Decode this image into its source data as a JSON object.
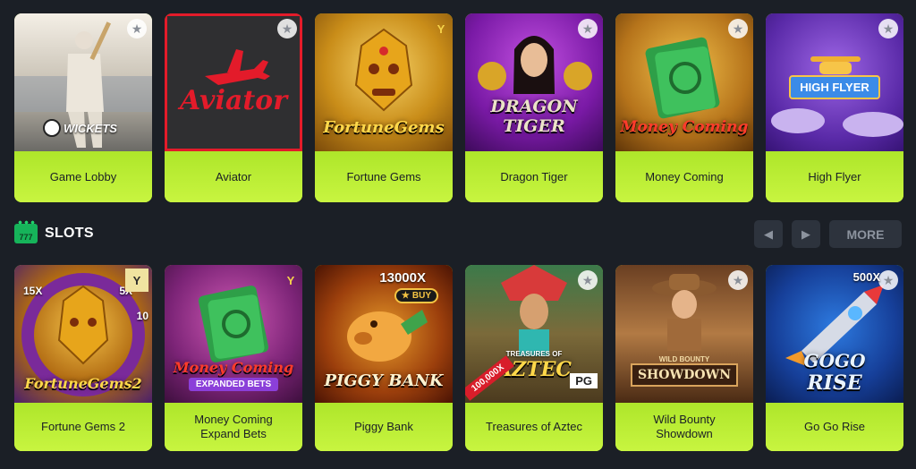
{
  "top_games": [
    {
      "label": "Game Lobby",
      "art_text": "WICKETS"
    },
    {
      "label": "Aviator",
      "art_text": "Aviator"
    },
    {
      "label": "Fortune Gems",
      "art_text": "FortuneGems"
    },
    {
      "label": "Dragon Tiger",
      "art_text_1": "DRAGON",
      "art_text_2": "TIGER"
    },
    {
      "label": "Money Coming",
      "art_text": "Money Coming"
    },
    {
      "label": "High Flyer",
      "art_text": "HIGH FLYER"
    }
  ],
  "section": {
    "title": "SLOTS",
    "icon": "slots-777-icon",
    "icon_text": "777"
  },
  "nav": {
    "prev_icon": "chevron-left-icon",
    "next_icon": "chevron-right-icon",
    "more_label": "MORE"
  },
  "slots_games": [
    {
      "label": "Fortune Gems 2",
      "art_text": "FortuneGems2",
      "badge_1": "15X",
      "badge_2": "5X",
      "badge_3": "10"
    },
    {
      "label": "Money Coming Expand Bets",
      "art_text": "Money Coming",
      "art_sub": "EXPANDED BETS"
    },
    {
      "label": "Piggy Bank",
      "art_text": "PIGGY BANK",
      "multiplier": "13000X",
      "buy": "BUY"
    },
    {
      "label": "Treasures of Aztec",
      "art_small": "TREASURES OF",
      "art_text": "AZTEC",
      "ribbon": "100,000X",
      "provider": "PG"
    },
    {
      "label": "Wild Bounty Showdown",
      "art_small": "WILD BOUNTY",
      "art_text": "SHOWDOWN"
    },
    {
      "label": "Go Go Rise",
      "art_text_1": "GOGO",
      "art_text_2": "RISE",
      "multiplier": "500X"
    }
  ],
  "favorite_icon": "star-icon",
  "colors": {
    "background": "#1b1f26",
    "card_label_bg": "#b6ef2c",
    "accent_green": "#16b35a",
    "button_bg": "#2d333d"
  }
}
